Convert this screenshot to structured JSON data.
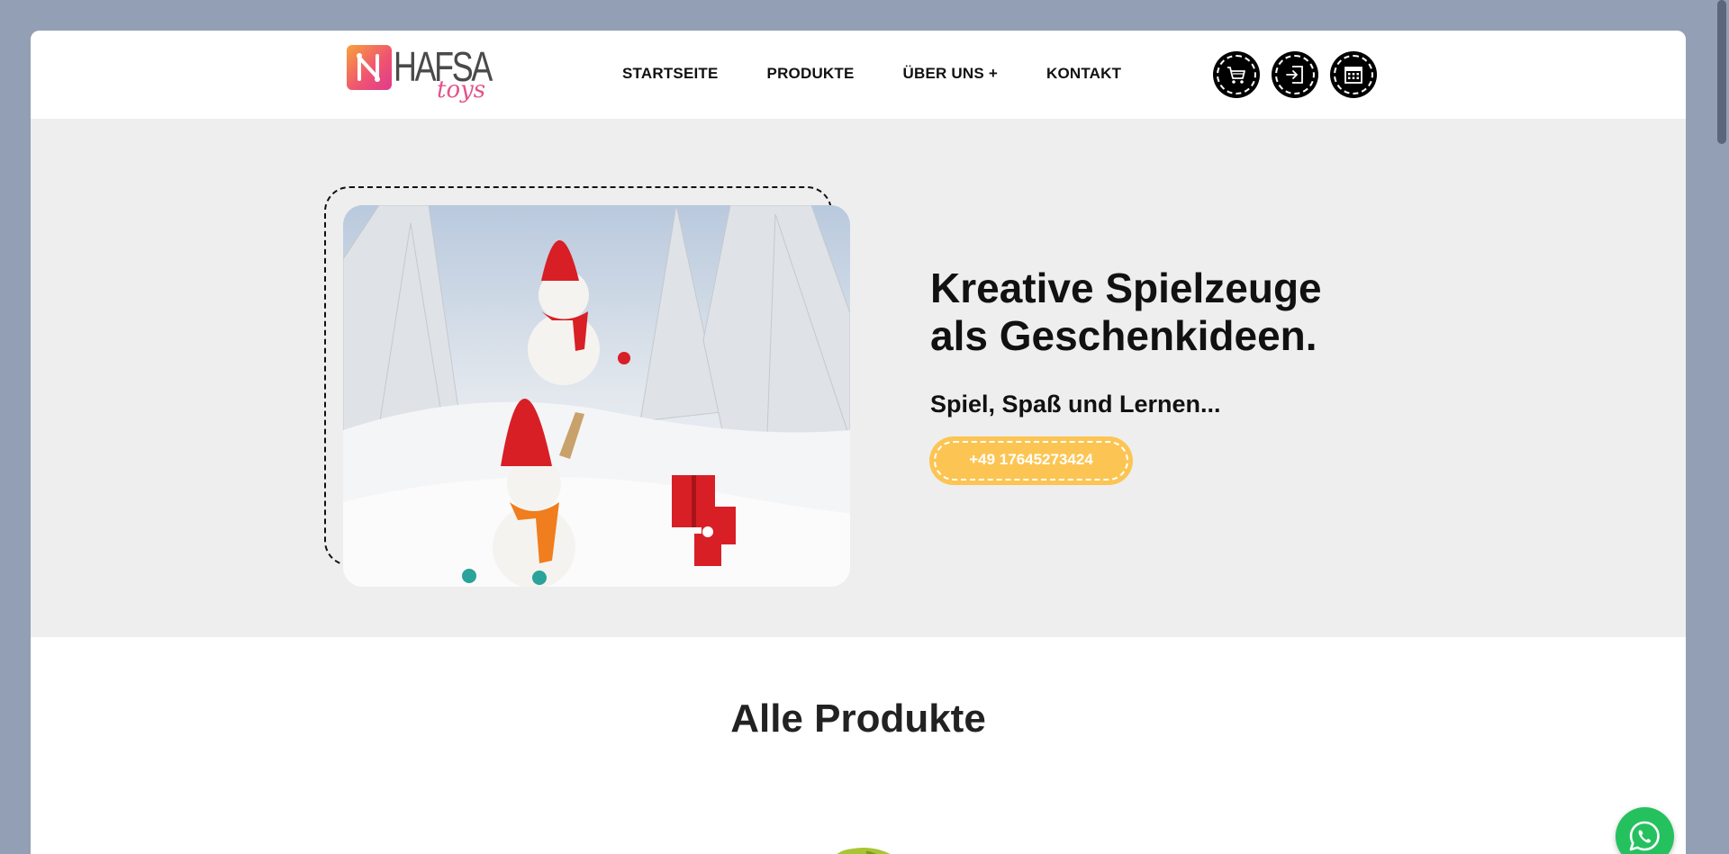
{
  "logo": {
    "name": "HAFSA",
    "sub": "toys"
  },
  "nav": {
    "items": [
      {
        "label": "STARTSEITE"
      },
      {
        "label": "PRODUKTE"
      },
      {
        "label": "ÜBER UNS +"
      },
      {
        "label": "KONTAKT"
      }
    ]
  },
  "header_icons": [
    "cart-icon",
    "login-icon",
    "calendar-icon"
  ],
  "hero": {
    "title_line1": "Kreative Spielzeuge",
    "title_line2": "als Geschenkideen.",
    "subtitle": "Spiel, Spaß und Lernen...",
    "phone": "+49 17645273424"
  },
  "products": {
    "title": "Alle Produkte"
  },
  "colors": {
    "page_bg": "#939fb5",
    "hero_bg": "#eeeeee",
    "accent": "#fcc553",
    "whatsapp": "#25c15f"
  }
}
